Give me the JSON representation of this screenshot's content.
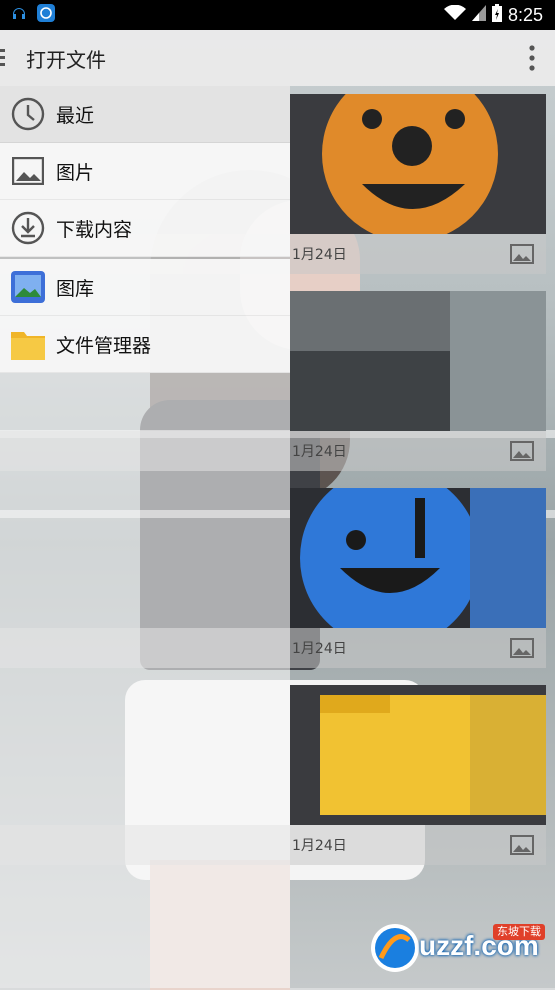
{
  "statusbar": {
    "time": "8:25"
  },
  "appbar": {
    "title": "打开文件"
  },
  "drawer": {
    "items": [
      {
        "label": "最近",
        "icon": "clock-icon",
        "selected": true
      },
      {
        "label": "图片",
        "icon": "image-icon",
        "selected": false
      },
      {
        "label": "下载内容",
        "icon": "download-icon",
        "selected": false
      }
    ],
    "apps": [
      {
        "label": "图库",
        "icon": "gallery-app-icon"
      },
      {
        "label": "文件管理器",
        "icon": "file-manager-folder-icon"
      }
    ]
  },
  "grid": {
    "items": [
      {
        "date": "1月24日",
        "thumb": "orange-smiley"
      },
      {
        "date": "1月24日",
        "thumb": "photo"
      },
      {
        "date": "1月24日",
        "thumb": "blue-smiley"
      },
      {
        "date": "1月24日",
        "thumb": "yellow-folder"
      }
    ]
  },
  "watermark": {
    "brand": "uzzf.com",
    "badge": "东坡下载"
  },
  "colors": {
    "drawer_bg": "#f6f6f6",
    "status_bg": "#000000",
    "accent_orange": "#e08a2a",
    "accent_blue": "#2f78d8"
  }
}
